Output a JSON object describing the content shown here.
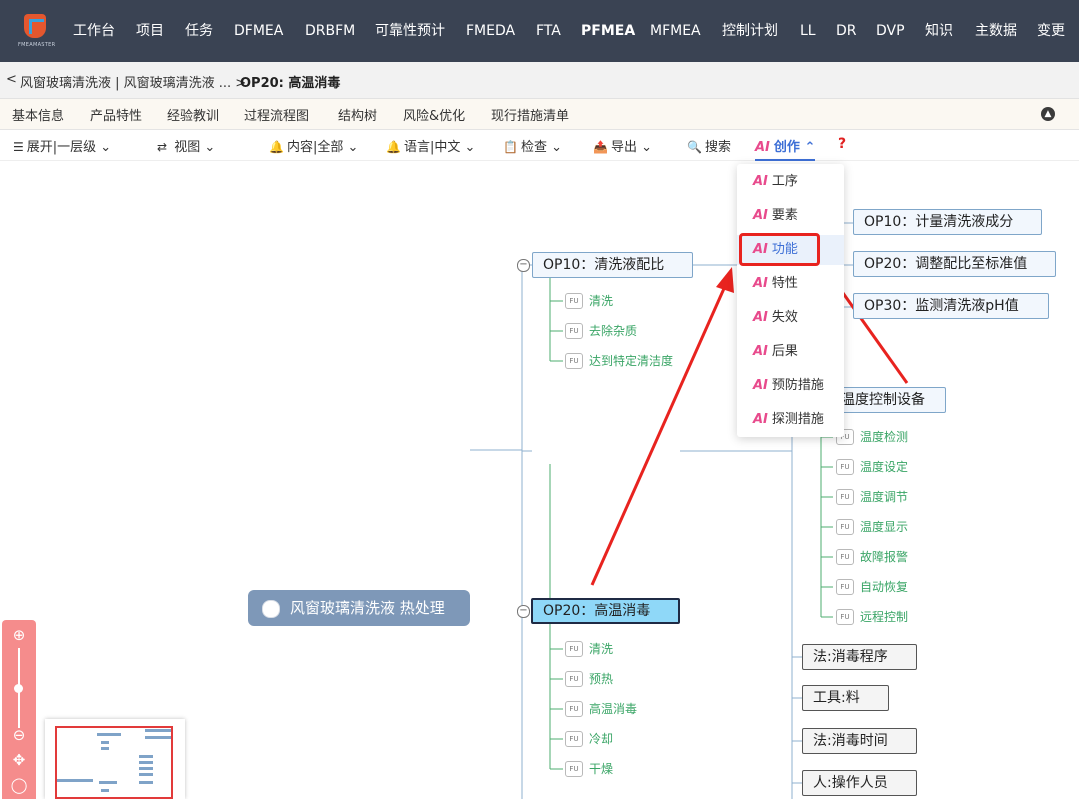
{
  "nav": {
    "logo_text": "FMEAMASTER",
    "items": [
      "工作台",
      "项目",
      "任务",
      "DFMEA",
      "DRBFM",
      "可靠性预计",
      "FMEDA",
      "FTA",
      "PFMEA",
      "MFMEA",
      "控制计划",
      "LL",
      "DR",
      "DVP",
      "知识",
      "主数据",
      "变更"
    ],
    "active": "PFMEA"
  },
  "breadcrumb": {
    "back": "<",
    "path": "风窗玻璃清洗液 | 风窗玻璃清洗液 ... >",
    "current": "OP20: 高温消毒"
  },
  "tabs": [
    "基本信息",
    "产品特性",
    "经验教训",
    "过程流程图",
    "结构树",
    "风险&优化",
    "现行措施清单"
  ],
  "toolbar": {
    "expand": "展开|一层级",
    "view": "视图",
    "content": "内容|全部",
    "language": "语言|中文",
    "check": "检查",
    "export": "导出",
    "search": "搜索",
    "ai_badge": "AI",
    "create": "创作",
    "help": "?"
  },
  "ai_menu": {
    "badge": "AI",
    "items": [
      "工序",
      "要素",
      "功能",
      "特性",
      "失效",
      "后果",
      "预防措施",
      "探测措施"
    ],
    "highlighted": "功能"
  },
  "mindmap": {
    "root": "风窗玻璃清洗液 热处理",
    "op10": "OP10：清洗液配比",
    "op10_functions": [
      "清洗",
      "去除杂质",
      "达到特定清洁度"
    ],
    "op10_children": [
      "OP10：计量清洗液成分",
      "OP20：调整配比至标准值",
      "OP30：监测清洗液pH值"
    ],
    "op20": "OP20：高温消毒",
    "op20_functions": [
      "清洗",
      "预热",
      "高温消毒",
      "冷却",
      "干燥"
    ],
    "equipment": "温度控制设备",
    "equipment_functions": [
      "温度检测",
      "温度设定",
      "温度调节",
      "温度显示",
      "故障报警",
      "自动恢复",
      "远程控制"
    ],
    "elements": [
      "法:消毒程序",
      "工具:料",
      "法:消毒时间",
      "人:操作人员"
    ],
    "fu_tag": "FU"
  },
  "zoom": {
    "in": "⊕",
    "out": "⊖",
    "move": "✥",
    "fit": "◯"
  },
  "colors": {
    "nav_bg": "#3a4353",
    "accent": "#3d6fd6",
    "ai": "#e84a8c",
    "highlight": "#e8231f",
    "fu_text": "#3aa566"
  }
}
